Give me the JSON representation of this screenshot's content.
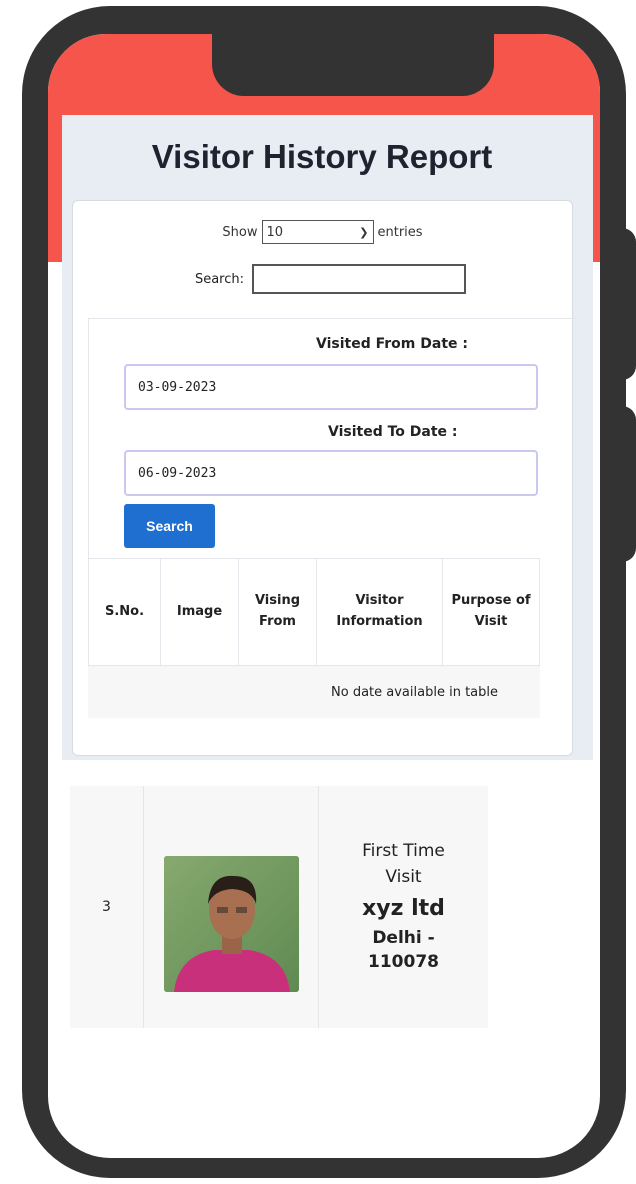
{
  "page_title": "Visitor History Report",
  "table_controls": {
    "show_label": "Show",
    "entries_value": "10",
    "entries_label": "entries",
    "search_label": "Search:"
  },
  "filters": {
    "from_label": "Visited From Date :",
    "from_value": "03-09-2023",
    "to_label": "Visited To Date :",
    "to_value": "06-09-2023",
    "search_button": "Search"
  },
  "table": {
    "headers": [
      "S.No.",
      "Image",
      "Vising From",
      "Visitor Information",
      "Purpose of Visit"
    ],
    "empty_message": "No date available in table"
  },
  "record": {
    "sno": "3",
    "visit_type": "First Time Visit",
    "company": "xyz ltd",
    "city": "Delhi - 110078"
  },
  "colors": {
    "header_band": "#f5554a",
    "phone_frame": "#333333",
    "search_button": "#1f6fd1"
  }
}
